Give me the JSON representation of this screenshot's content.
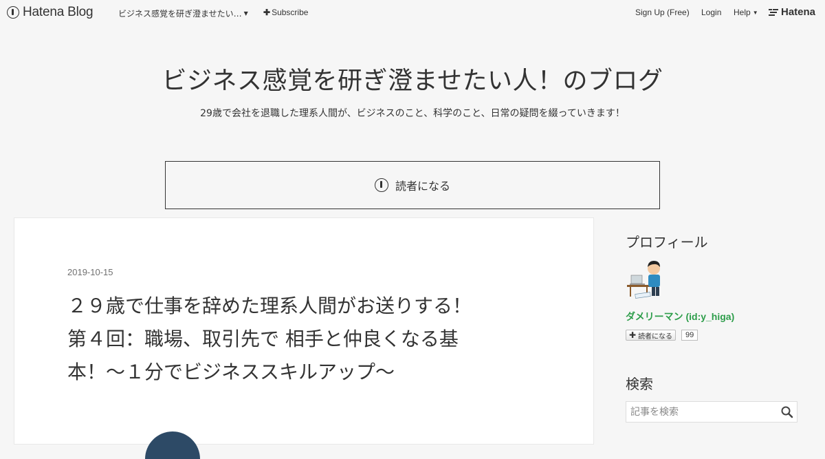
{
  "nav": {
    "logo_text": "Hatena Blog",
    "blog_menu_label": "ビジネス感覚を研ぎ澄ませたい…",
    "subscribe_label": "Subscribe",
    "signup_label": "Sign Up (Free)",
    "login_label": "Login",
    "help_label": "Help",
    "brand_label": "Hatena",
    "icons": [
      "hatena-blog-logo-icon",
      "caret-down-icon",
      "plus-icon",
      "hatena-brand-icon"
    ]
  },
  "header": {
    "title": "ビジネス感覚を研ぎ澄ませたい人！のブログ",
    "description": "29歳で会社を退職した理系人間が、ビジネスのこと、科学のこと、日常の疑問を綴っていきます！",
    "subscribe_label": "読者になる"
  },
  "article": {
    "date": "2019-10-15",
    "title_lines": [
      "２９歳で仕事を辞めた理系人間がお送りする！",
      "第４回：職場、取引先で 相手と仲良くなる基",
      "本！〜１分でビジネススキルアップ〜"
    ]
  },
  "sidebar": {
    "profile_title": "プロフィール",
    "profile_name": "ダメリーマン (id:y_higa)",
    "reader_button_label": "読者になる",
    "reader_count": "99",
    "search_title": "検索",
    "search_placeholder": "記事を検索"
  },
  "colors": {
    "background": "#f6f6f6",
    "text": "#333333",
    "profile_link": "#2d9d4a",
    "date": "#707070"
  }
}
